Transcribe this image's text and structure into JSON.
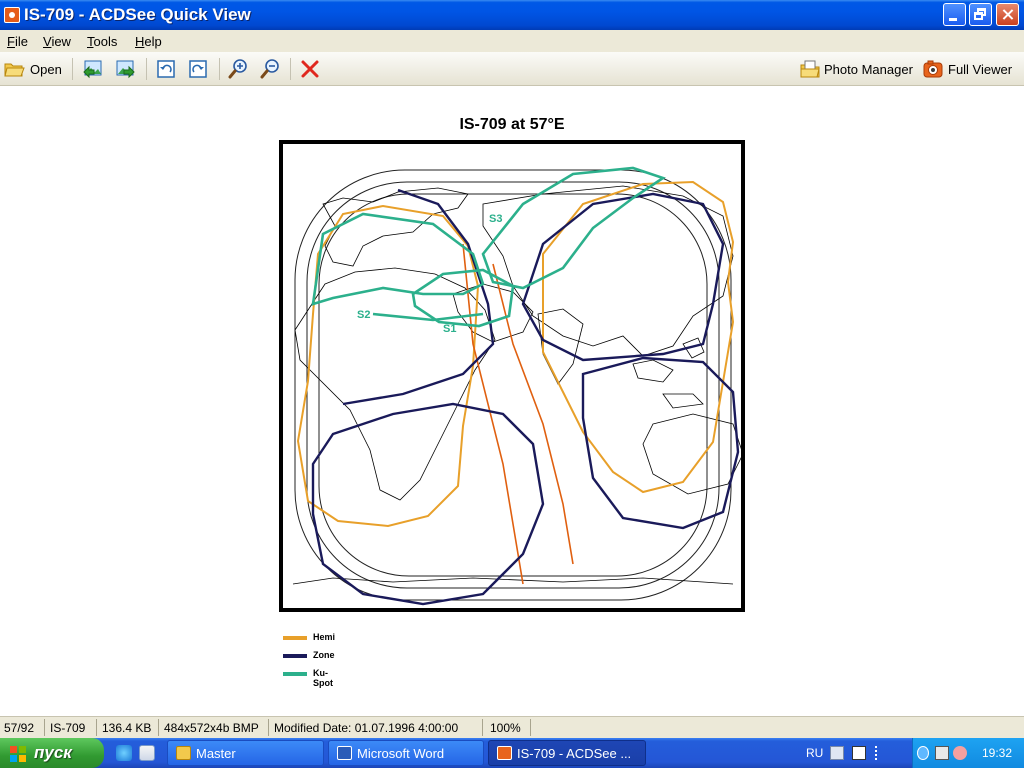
{
  "window": {
    "title": "IS-709 - ACDSee Quick View"
  },
  "menu": [
    {
      "label": "File"
    },
    {
      "label": "View"
    },
    {
      "label": "Tools"
    },
    {
      "label": "Help"
    }
  ],
  "toolbar": {
    "open_label": "Open",
    "photo_manager_label": "Photo Manager",
    "full_viewer_label": "Full Viewer",
    "icons": [
      "open-folder-icon",
      "previous-image-icon",
      "next-image-icon",
      "rotate-left-icon",
      "rotate-right-icon",
      "zoom-in-icon",
      "zoom-out-icon",
      "delete-icon",
      "photo-manager-icon",
      "full-viewer-icon"
    ],
    "delete_color": "#e0281e"
  },
  "image": {
    "title": "IS-709 at 57°E",
    "spots": [
      "S3",
      "S2",
      "S1"
    ],
    "legend": [
      {
        "label": "Hemi",
        "color": "#e8a02a"
      },
      {
        "label": "Zone",
        "color": "#1a1a5a"
      },
      {
        "label": "Ku-Spot",
        "color": "#2cb08c"
      }
    ]
  },
  "status": {
    "position": "57/92",
    "name": "IS-709",
    "size": "136.4 KB",
    "dimensions": "484x572x4b BMP",
    "modified": "Modified Date: 01.07.1996 4:00:00",
    "zoom": "100%"
  },
  "taskbar": {
    "start_label": "пуск",
    "tasks": [
      {
        "label": "Master"
      },
      {
        "label": "Microsoft Word"
      },
      {
        "label": "IS-709 - ACDSee ..."
      }
    ],
    "language": "RU",
    "clock": "19:32"
  }
}
